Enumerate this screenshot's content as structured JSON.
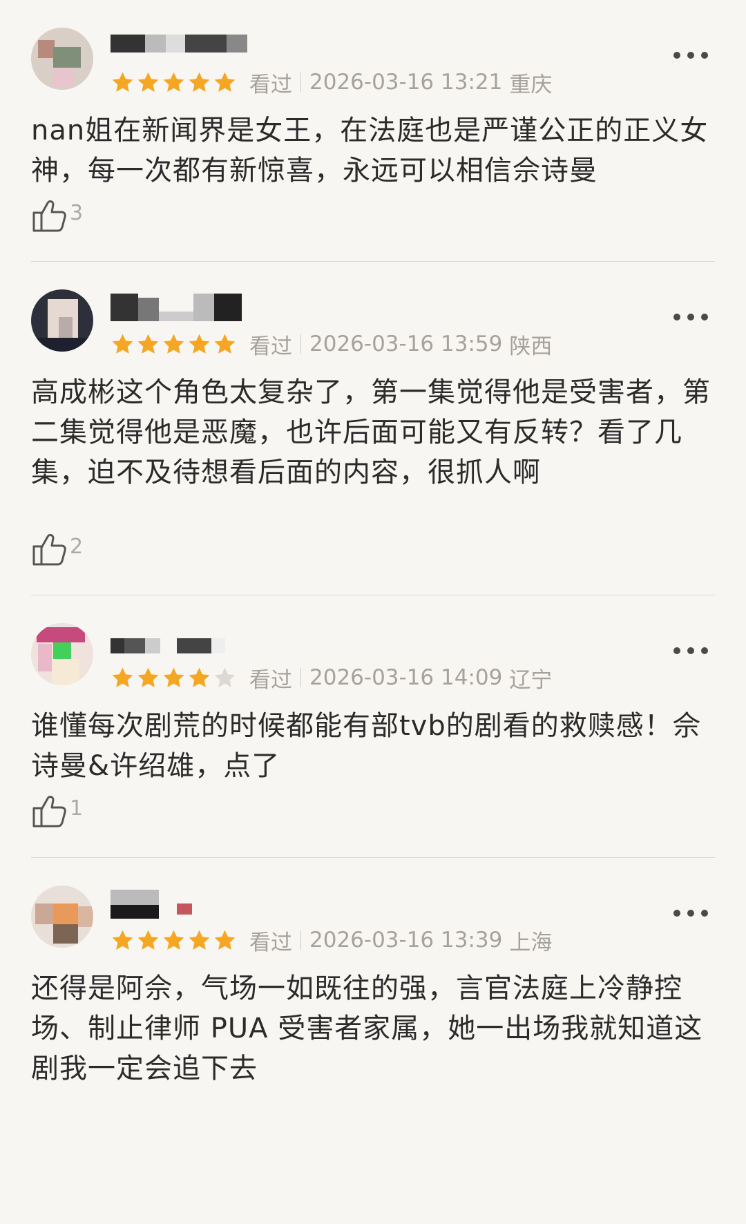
{
  "colors": {
    "background": "#f8f6f3",
    "star_filled": "#f5a623",
    "star_empty": "#dcd8d3",
    "meta_text": "#a6a19b",
    "content_text": "#2b2b2b"
  },
  "reviews": [
    {
      "status": "看过",
      "timestamp": "2026-03-16 13:21",
      "location": "重庆",
      "rating": 5,
      "content": "nan姐在新闻界是女王，在法庭也是严谨公正的正义女神，每一次都有新惊喜，永远可以相信佘诗曼",
      "likes": "3",
      "icons": {
        "like": "thumbs-up-icon",
        "more": "more-dots-icon"
      }
    },
    {
      "status": "看过",
      "timestamp": "2026-03-16 13:59",
      "location": "陕西",
      "rating": 5,
      "content": "高成彬这个角色太复杂了，第一集觉得他是受害者，第二集觉得他是恶魔，也许后面可能又有反转？看了几集，迫不及待想看后面的内容，很抓人啊",
      "likes": "2",
      "icons": {
        "like": "thumbs-up-icon",
        "more": "more-dots-icon"
      }
    },
    {
      "status": "看过",
      "timestamp": "2026-03-16 14:09",
      "location": "辽宁",
      "rating": 4,
      "content": "谁懂每次剧荒的时候都能有部tvb的剧看的救赎感！佘诗曼&许绍雄，点了",
      "likes": "1",
      "icons": {
        "like": "thumbs-up-icon",
        "more": "more-dots-icon"
      }
    },
    {
      "status": "看过",
      "timestamp": "2026-03-16 13:39",
      "location": "上海",
      "rating": 5,
      "content": "还得是阿佘，气场一如既往的强，言官法庭上冷静控场、制止律师 PUA 受害者家属，她一出场我就知道这剧我一定会追下去",
      "likes": "",
      "icons": {
        "like": "thumbs-up-icon",
        "more": "more-dots-icon"
      }
    }
  ]
}
